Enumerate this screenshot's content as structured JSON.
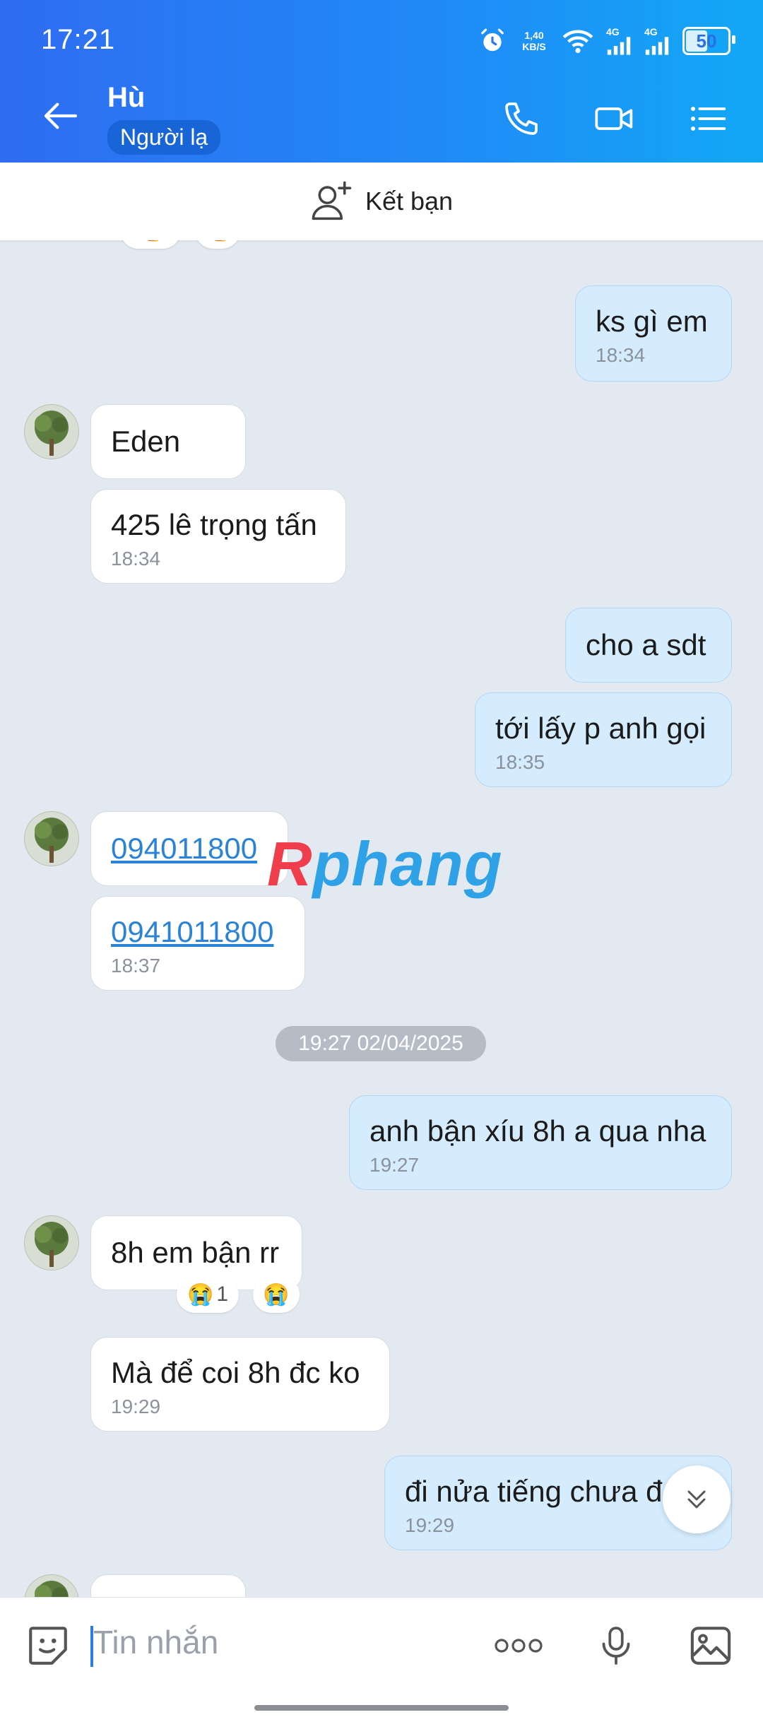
{
  "status_bar": {
    "time": "17:21",
    "speed": "1,40\nKB/S",
    "net1": "4G",
    "net2": "4G",
    "battery": "50"
  },
  "header": {
    "contact_name": "Hù",
    "badge": "Người lạ"
  },
  "friend_bar": {
    "label": "Kết bạn"
  },
  "messages": [
    {
      "dir": "out",
      "text": "ks gì em",
      "time": "18:34"
    },
    {
      "dir": "in",
      "text": "Eden"
    },
    {
      "dir": "in",
      "text": "425 lê trọng tấn",
      "time": "18:34"
    },
    {
      "dir": "out",
      "text": "cho a sdt"
    },
    {
      "dir": "out",
      "text": "tới lấy p anh gọi",
      "time": "18:35"
    },
    {
      "dir": "in",
      "text": "094011800"
    },
    {
      "dir": "in",
      "text": "0941011800",
      "time": "18:37"
    },
    {
      "dir": "out",
      "text": "anh bận xíu 8h a qua nha",
      "time": "19:27"
    },
    {
      "dir": "in",
      "text": "8h em bận rr"
    },
    {
      "dir": "in",
      "text": "Mà để coi 8h đc ko",
      "time": "19:29"
    },
    {
      "dir": "out",
      "text": "đi nửa tiếng chưa đ",
      "time": "19:29"
    }
  ],
  "date_separator": "19:27 02/04/2025",
  "reactions": {
    "count": "1",
    "emoji": "😭"
  },
  "watermark": {
    "part1": "R",
    "part2": "phang"
  },
  "input": {
    "placeholder": "Tin nhắn"
  },
  "colors": {
    "header_start": "#2f6cf2",
    "header_end": "#12a8f6",
    "out_bubble": "#d4ecfd",
    "in_bubble": "#ffffff",
    "chat_bg": "#e2e9f1",
    "link": "#2b83d8"
  }
}
